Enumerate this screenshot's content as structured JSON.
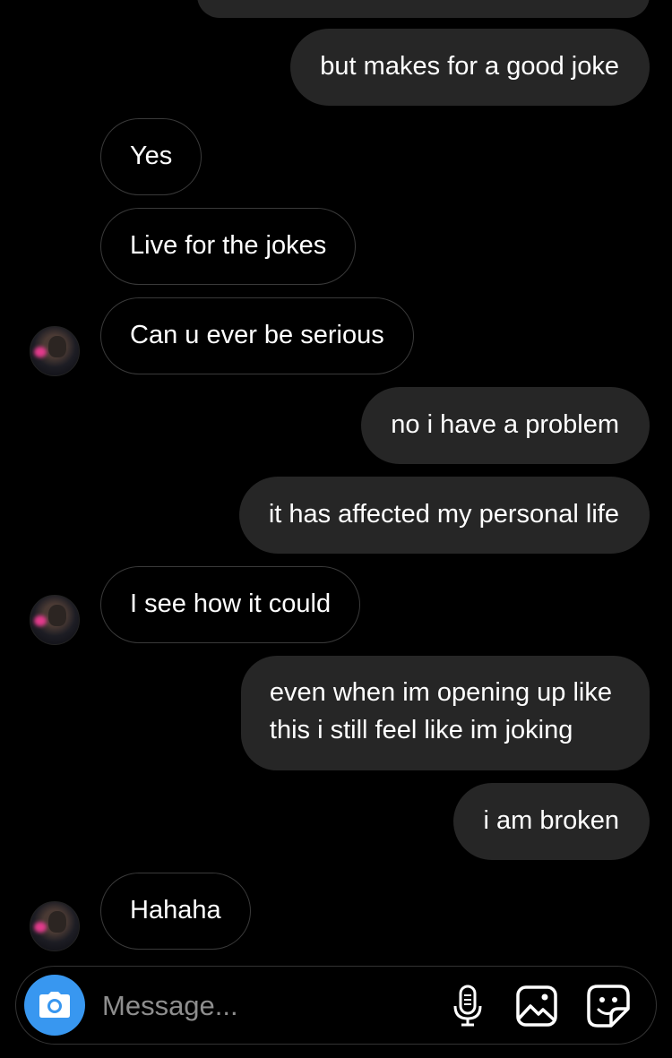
{
  "messages": [
    {
      "side": "sent",
      "text": "but makes for a good joke"
    },
    {
      "side": "received",
      "text": "Yes"
    },
    {
      "side": "received",
      "text": "Live for the jokes"
    },
    {
      "side": "received",
      "text": "Can u ever be serious"
    },
    {
      "side": "sent",
      "text": "no i have a problem"
    },
    {
      "side": "sent",
      "text": "it has affected my personal life"
    },
    {
      "side": "received",
      "text": "I see how it could"
    },
    {
      "side": "sent",
      "lines": [
        "even when im opening up like",
        "this i still feel like im joking"
      ]
    },
    {
      "side": "sent",
      "text": "i am broken"
    },
    {
      "side": "received",
      "text": "Hahaha"
    }
  ],
  "composer": {
    "placeholder": "Message...",
    "icons": [
      "camera-icon",
      "microphone-icon",
      "gallery-icon",
      "sticker-icon"
    ]
  },
  "colors": {
    "background": "#000000",
    "sent_bubble": "#262626",
    "received_border": "#3a3a3a",
    "camera_button": "#3897f0",
    "placeholder": "#8e8e8e"
  }
}
